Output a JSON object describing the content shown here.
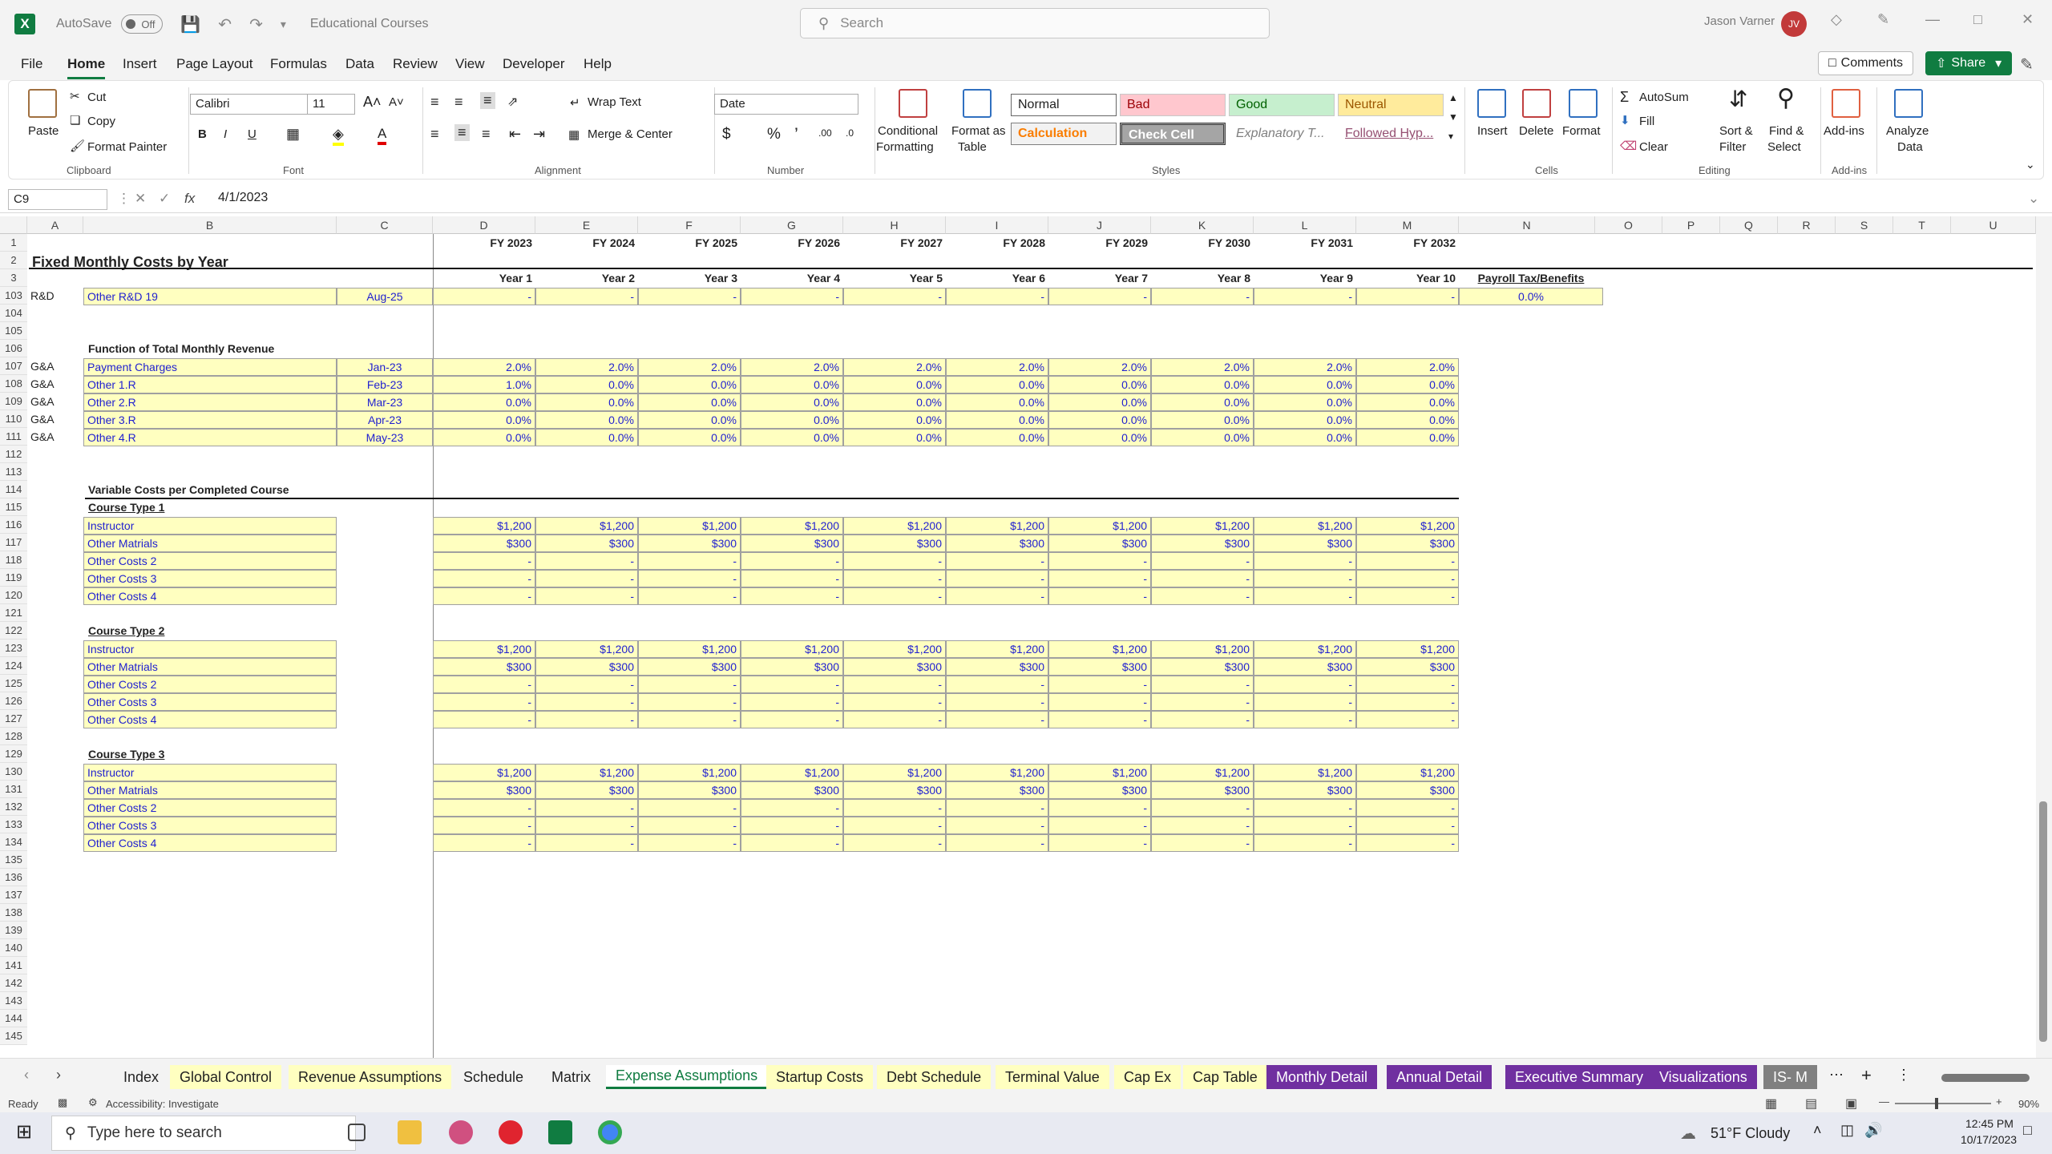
{
  "titlebar": {
    "autosave_label": "AutoSave",
    "autosave_state": "Off",
    "file_name": "Educational Courses",
    "search_placeholder": "Search",
    "user_name": "Jason Varner",
    "user_initials": "JV"
  },
  "menu": [
    "File",
    "Home",
    "Insert",
    "Page Layout",
    "Formulas",
    "Data",
    "Review",
    "View",
    "Developer",
    "Help"
  ],
  "comments_label": "Comments",
  "share_label": "Share",
  "ribbon": {
    "paste": "Paste",
    "cut": "Cut",
    "copy": "Copy",
    "format_painter": "Format Painter",
    "clipboard": "Clipboard",
    "font_name": "Calibri",
    "font_size": "11",
    "font": "Font",
    "wrap_text": "Wrap Text",
    "merge_center": "Merge & Center",
    "alignment": "Alignment",
    "number_format": "Date",
    "number": "Number",
    "conditional": "Conditional",
    "formatting": "Formatting",
    "format_as": "Format as",
    "table": "Table",
    "styles_label": "Styles",
    "styles": {
      "normal": "Normal",
      "bad": "Bad",
      "good": "Good",
      "neutral": "Neutral",
      "calculation": "Calculation",
      "check_cell": "Check Cell",
      "explanatory": "Explanatory T...",
      "followed": "Followed Hyp..."
    },
    "insert": "Insert",
    "delete": "Delete",
    "format": "Format",
    "cells": "Cells",
    "autosum": "AutoSum",
    "fill": "Fill",
    "clear": "Clear",
    "sort_filter_1": "Sort &",
    "sort_filter_2": "Filter",
    "find_select_1": "Find &",
    "find_select_2": "Select",
    "editing": "Editing",
    "addins": "Add-ins",
    "addins_group": "Add-ins",
    "analyze_1": "Analyze",
    "analyze_2": "Data"
  },
  "formula_bar": {
    "name_box": "C9",
    "formula": "4/1/2023"
  },
  "columns": [
    "A",
    "B",
    "C",
    "D",
    "E",
    "F",
    "G",
    "H",
    "I",
    "J",
    "K",
    "L",
    "M",
    "N",
    "O",
    "P",
    "Q",
    "R",
    "S",
    "T",
    "U"
  ],
  "sheet": {
    "title": "Fixed Monthly Costs by Year",
    "fy": [
      "FY 2023",
      "FY 2024",
      "FY 2025",
      "FY 2026",
      "FY 2027",
      "FY 2028",
      "FY 2029",
      "FY 2030",
      "FY 2031",
      "FY 2032"
    ],
    "years": [
      "Year 1",
      "Year 2",
      "Year 3",
      "Year 4",
      "Year 5",
      "Year 6",
      "Year 7",
      "Year 8",
      "Year 9",
      "Year 10"
    ],
    "payroll_label": "Payroll Tax/Benefits",
    "payroll_value": "0.0%",
    "rd_row": {
      "a": "R&D",
      "b": "Other R&D 19",
      "c": "Aug-25",
      "vals": [
        "-",
        "-",
        "-",
        "-",
        "-",
        "-",
        "-",
        "-",
        "-",
        "-"
      ]
    },
    "func_header": "Function of Total Monthly Revenue",
    "func_rows": [
      {
        "a": "G&A",
        "b": "Payment Charges",
        "c": "Jan-23",
        "vals": [
          "2.0%",
          "2.0%",
          "2.0%",
          "2.0%",
          "2.0%",
          "2.0%",
          "2.0%",
          "2.0%",
          "2.0%",
          "2.0%"
        ]
      },
      {
        "a": "G&A",
        "b": "Other 1.R",
        "c": "Feb-23",
        "vals": [
          "1.0%",
          "0.0%",
          "0.0%",
          "0.0%",
          "0.0%",
          "0.0%",
          "0.0%",
          "0.0%",
          "0.0%",
          "0.0%"
        ]
      },
      {
        "a": "G&A",
        "b": "Other 2.R",
        "c": "Mar-23",
        "vals": [
          "0.0%",
          "0.0%",
          "0.0%",
          "0.0%",
          "0.0%",
          "0.0%",
          "0.0%",
          "0.0%",
          "0.0%",
          "0.0%"
        ]
      },
      {
        "a": "G&A",
        "b": "Other 3.R",
        "c": "Apr-23",
        "vals": [
          "0.0%",
          "0.0%",
          "0.0%",
          "0.0%",
          "0.0%",
          "0.0%",
          "0.0%",
          "0.0%",
          "0.0%",
          "0.0%"
        ]
      },
      {
        "a": "G&A",
        "b": "Other 4.R",
        "c": "May-23",
        "vals": [
          "0.0%",
          "0.0%",
          "0.0%",
          "0.0%",
          "0.0%",
          "0.0%",
          "0.0%",
          "0.0%",
          "0.0%",
          "0.0%"
        ]
      }
    ],
    "var_header": "Variable Costs per Completed Course",
    "course_types": [
      {
        "name": "Course Type 1",
        "rows": [
          {
            "b": "Instructor",
            "vals": [
              "$1,200",
              "$1,200",
              "$1,200",
              "$1,200",
              "$1,200",
              "$1,200",
              "$1,200",
              "$1,200",
              "$1,200",
              "$1,200"
            ]
          },
          {
            "b": "Other Matrials",
            "vals": [
              "$300",
              "$300",
              "$300",
              "$300",
              "$300",
              "$300",
              "$300",
              "$300",
              "$300",
              "$300"
            ]
          },
          {
            "b": "Other Costs 2",
            "vals": [
              "-",
              "-",
              "-",
              "-",
              "-",
              "-",
              "-",
              "-",
              "-",
              "-"
            ]
          },
          {
            "b": "Other Costs 3",
            "vals": [
              "-",
              "-",
              "-",
              "-",
              "-",
              "-",
              "-",
              "-",
              "-",
              "-"
            ]
          },
          {
            "b": "Other Costs 4",
            "vals": [
              "-",
              "-",
              "-",
              "-",
              "-",
              "-",
              "-",
              "-",
              "-",
              "-"
            ]
          }
        ]
      },
      {
        "name": "Course Type 2",
        "rows": [
          {
            "b": "Instructor",
            "vals": [
              "$1,200",
              "$1,200",
              "$1,200",
              "$1,200",
              "$1,200",
              "$1,200",
              "$1,200",
              "$1,200",
              "$1,200",
              "$1,200"
            ]
          },
          {
            "b": "Other Matrials",
            "vals": [
              "$300",
              "$300",
              "$300",
              "$300",
              "$300",
              "$300",
              "$300",
              "$300",
              "$300",
              "$300"
            ]
          },
          {
            "b": "Other Costs 2",
            "vals": [
              "-",
              "-",
              "-",
              "-",
              "-",
              "-",
              "-",
              "-",
              "-",
              "-"
            ]
          },
          {
            "b": "Other Costs 3",
            "vals": [
              "-",
              "-",
              "-",
              "-",
              "-",
              "-",
              "-",
              "-",
              "-",
              "-"
            ]
          },
          {
            "b": "Other Costs 4",
            "vals": [
              "-",
              "-",
              "-",
              "-",
              "-",
              "-",
              "-",
              "-",
              "-",
              "-"
            ]
          }
        ]
      },
      {
        "name": "Course Type 3",
        "rows": [
          {
            "b": "Instructor",
            "vals": [
              "$1,200",
              "$1,200",
              "$1,200",
              "$1,200",
              "$1,200",
              "$1,200",
              "$1,200",
              "$1,200",
              "$1,200",
              "$1,200"
            ]
          },
          {
            "b": "Other Matrials",
            "vals": [
              "$300",
              "$300",
              "$300",
              "$300",
              "$300",
              "$300",
              "$300",
              "$300",
              "$300",
              "$300"
            ]
          },
          {
            "b": "Other Costs 2",
            "vals": [
              "-",
              "-",
              "-",
              "-",
              "-",
              "-",
              "-",
              "-",
              "-",
              "-"
            ]
          },
          {
            "b": "Other Costs 3",
            "vals": [
              "-",
              "-",
              "-",
              "-",
              "-",
              "-",
              "-",
              "-",
              "-",
              "-"
            ]
          },
          {
            "b": "Other Costs 4",
            "vals": [
              "-",
              "-",
              "-",
              "-",
              "-",
              "-",
              "-",
              "-",
              "-",
              "-"
            ]
          }
        ]
      }
    ],
    "row_numbers": [
      "1",
      "2",
      "3",
      "103",
      "104",
      "105",
      "106",
      "107",
      "108",
      "109",
      "110",
      "111",
      "112",
      "113",
      "114",
      "115",
      "116",
      "117",
      "118",
      "119",
      "120",
      "121",
      "122",
      "123",
      "124",
      "125",
      "126",
      "127",
      "128",
      "129",
      "130",
      "131",
      "132",
      "133",
      "134",
      "135",
      "136",
      "137",
      "138",
      "139",
      "140",
      "141",
      "142",
      "143",
      "144",
      "145"
    ]
  },
  "sheet_tabs": [
    {
      "label": "Index",
      "style": "plain"
    },
    {
      "label": "Global Control",
      "style": "y"
    },
    {
      "label": "Revenue Assumptions",
      "style": "y"
    },
    {
      "label": "Schedule",
      "style": "plain"
    },
    {
      "label": "Matrix",
      "style": "plain"
    },
    {
      "label": "Expense Assumptions",
      "style": "active"
    },
    {
      "label": "Startup Costs",
      "style": "y"
    },
    {
      "label": "Debt Schedule",
      "style": "y"
    },
    {
      "label": "Terminal Value",
      "style": "y"
    },
    {
      "label": "Cap Ex",
      "style": "y"
    },
    {
      "label": "Cap Table",
      "style": "y"
    },
    {
      "label": "Monthly Detail",
      "style": "p"
    },
    {
      "label": "Annual Detail",
      "style": "p"
    },
    {
      "label": "Executive Summary",
      "style": "p"
    },
    {
      "label": "Visualizations",
      "style": "p"
    },
    {
      "label": "IS- M",
      "style": "g"
    }
  ],
  "status": {
    "ready": "Ready",
    "accessibility": "Accessibility: Investigate",
    "zoom": "90%"
  },
  "taskbar": {
    "search_placeholder": "Type here to search",
    "weather": "51°F  Cloudy",
    "time": "12:45 PM",
    "date": "10/17/2023"
  },
  "colors": {
    "excel_green": "#107c41",
    "input_yellow": "#ffffc0",
    "input_blue": "#1f1fd0",
    "tab_purple": "#7030a0"
  }
}
